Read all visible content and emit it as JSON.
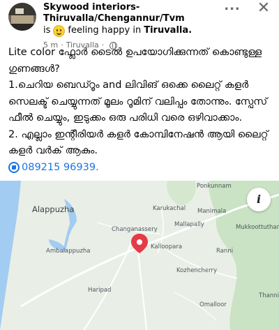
{
  "post": {
    "author": "Skywood interiors-Thiruvalla/Chengannur/Tvm",
    "feeling_prefix": "is",
    "feeling_text": "feeling happy in",
    "feeling_place": "Tiruvalla.",
    "time": "5 m",
    "meta_separator": "·",
    "location": "Tiruvalla",
    "more_label": "...",
    "close_label": "✕",
    "body_lines": [
      "Lite color ഫ്ലോർ ടൈൽ ഉപയോഗിക്കുന്നത് കൊണ്ടുള്ള ഗുണങ്ങൾ?",
      "1.ചെറിയ ബെഡ്റൂം and ലിവിങ് ഒക്കെ ലൈറ്റ് കളർ സെലക്ട് ചെയ്യുന്നത് മൂലം റൂമിന് വലിപ്പം തോന്നും. സ്പേസ് ഫീൽ ചെയ്യും, ഇടുക്കം ഒരു പരിധി വരെ ഒഴിവാക്കാം.",
      "2. എല്ലാം ഇന്റീരിയർ കളർ കോമ്പിനേഷൻ ആയി ലൈറ്റ് കളർ വർക് ആകും."
    ],
    "phone": "089215 96939",
    "phone_suffix": "."
  },
  "map": {
    "labels": {
      "alappuzha": "Alappuzha",
      "ponkunnam": "Ponkunnam",
      "karukachal": "Karukachal",
      "manimala": "Manimala",
      "mallapally": "Mallapally",
      "mukkoottuthara": "Mukkoottuthara",
      "changanassery": "Changanassery",
      "kalloppara": "Kalloopara",
      "ambalappuzha": "Ambalappuzha",
      "ranni": "Ranni",
      "kozhencherry": "Kozhencherry",
      "haripad": "Haripad",
      "omalloor": "Omalloor",
      "thannithodu": "Thannit"
    },
    "info_label": "i",
    "colors": {
      "land": "#e9efe6",
      "sea": "#a3ccf2",
      "forest": "#c9e3c4",
      "pin": "#e53b46",
      "road": "#ffffff"
    }
  }
}
